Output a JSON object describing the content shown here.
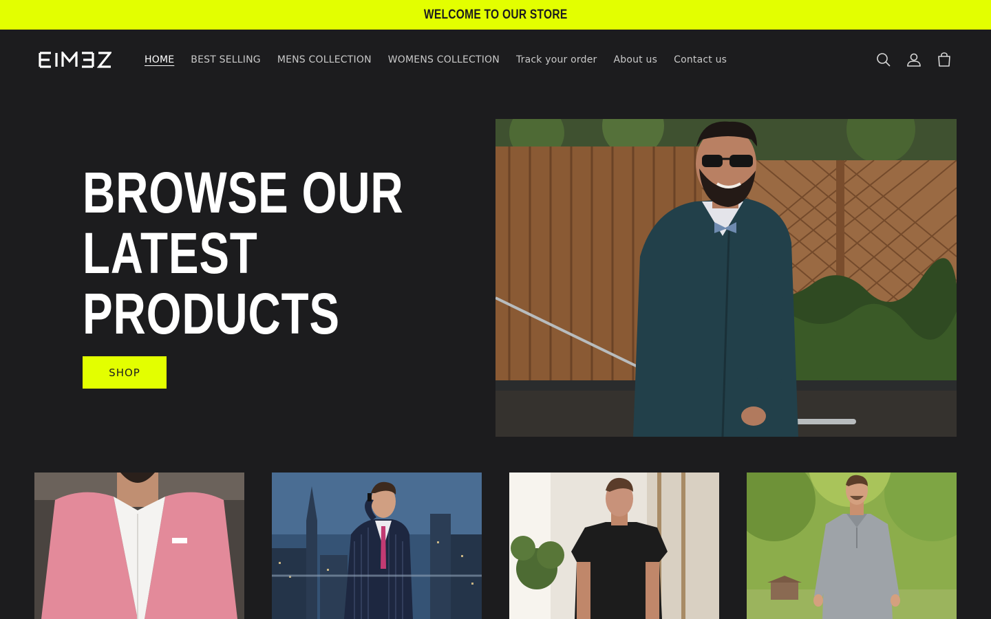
{
  "announcement": {
    "text": "WELCOME TO OUR STORE"
  },
  "header": {
    "logo_text": "EIM3Z",
    "nav": [
      {
        "label": "HOME",
        "active": true
      },
      {
        "label": "BEST SELLING",
        "active": false
      },
      {
        "label": "MENS COLLECTION",
        "active": false
      },
      {
        "label": "WOMENS COLLECTION",
        "active": false
      },
      {
        "label": "Track your order",
        "active": false
      },
      {
        "label": "About us",
        "active": false
      },
      {
        "label": "Contact us",
        "active": false
      }
    ],
    "icons": [
      "search-icon",
      "account-icon",
      "cart-icon"
    ]
  },
  "hero": {
    "title_lines": [
      "BROWSE OUR",
      "LATEST",
      "PRODUCTS"
    ],
    "button_label": "SHOP"
  },
  "products": [
    {
      "image": "pink-blazer-man"
    },
    {
      "image": "pinstripe-suit-man-city"
    },
    {
      "image": "black-tshirt-man"
    },
    {
      "image": "grey-polo-set-man-park"
    }
  ],
  "colors": {
    "accent": "#e3ff00",
    "background": "#1c1c1e",
    "text": "#ffffff",
    "nav_text": "#c9c9c9"
  }
}
